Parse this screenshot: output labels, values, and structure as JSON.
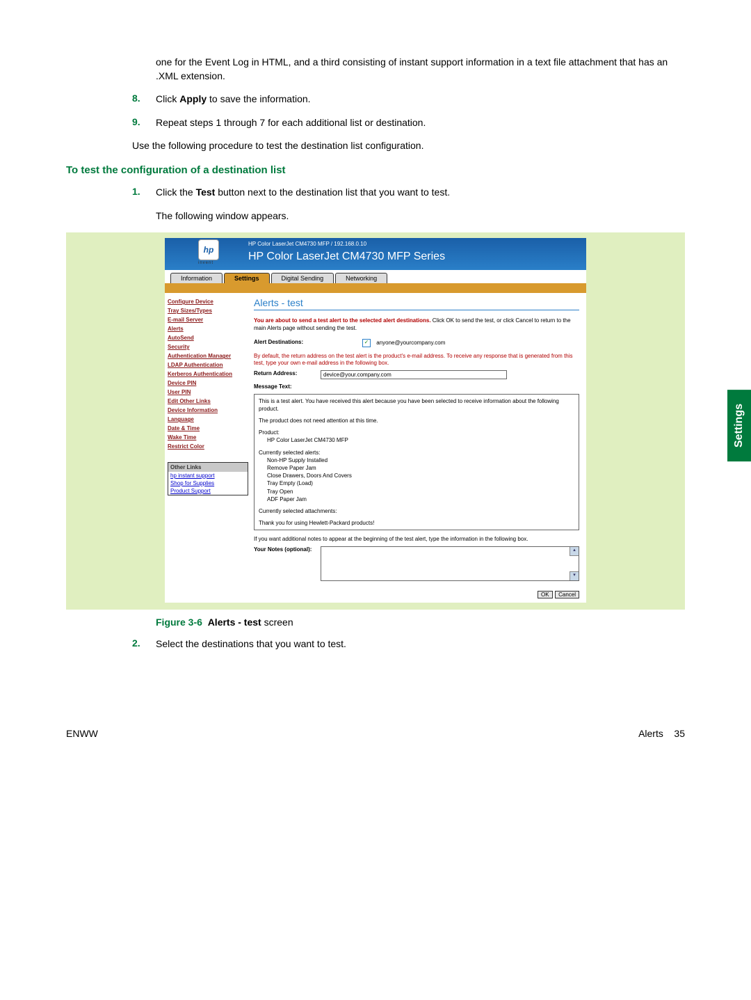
{
  "sideTab": "Settings",
  "introTrailing": "one for the Event Log in HTML, and a third consisting of instant support information in a text file attachment that has an .XML extension.",
  "steps_top": [
    {
      "num": "8.",
      "html": "Click <b>Apply</b> to save the information."
    },
    {
      "num": "9.",
      "html": "Repeat steps 1 through 7 for each additional list or destination."
    }
  ],
  "paraAfterTopSteps": "Use the following procedure to test the destination list configuration.",
  "heading": "To test the configuration of a destination list",
  "steps_mid": [
    {
      "num": "1.",
      "html": "Click the <b>Test</b> button next to the destination list that you want to test.",
      "sub": "The following window appears."
    }
  ],
  "figure": {
    "label": "Figure 3-6",
    "title_bold": "Alerts - test",
    "title_rest": " screen"
  },
  "steps_bottom": [
    {
      "num": "2.",
      "html": "Select the destinations that you want to test."
    }
  ],
  "footer": {
    "left": "ENWW",
    "right_label": "Alerts",
    "right_page": "35"
  },
  "screenshot": {
    "logo_text": "hp",
    "invent": "invent",
    "device_line": "HP Color LaserJet CM4730 MFP / 192.168.0.10",
    "device_title": "HP Color LaserJet CM4730 MFP Series",
    "tabs": [
      "Information",
      "Settings",
      "Digital Sending",
      "Networking"
    ],
    "active_tab": "Settings",
    "sidebar": [
      "Configure Device",
      "Tray Sizes/Types",
      "E-mail Server",
      "Alerts",
      "AutoSend",
      "Security",
      "Authentication Manager",
      "LDAP Authentication",
      "Kerberos Authentication",
      "Device PIN",
      "User PIN",
      "Edit Other Links",
      "Device Information",
      "Language",
      "Date & Time",
      "Wake Time",
      "Restrict Color"
    ],
    "other_links_title": "Other Links",
    "other_links": [
      "hp instant support",
      "Shop for Supplies",
      "Product Support"
    ],
    "panel_title": "Alerts - test",
    "warn_red": "You are about to send a test alert to the selected alert destinations.",
    "warn_rest": " Click OK to send the test, or click Cancel to return to the main Alerts page without sending the test.",
    "alert_dest_label": "Alert Destinations:",
    "alert_dest_value": "anyone@yourcompany.com",
    "return_note": "By default, the return address on the test alert is the product's e-mail address. To receive any response that is generated from this test, type your own e-mail address in the following box.",
    "return_label": "Return Address:",
    "return_value": "device@your.company.com",
    "msg_label": "Message Text:",
    "msg_intro": "This is a test alert. You have received this alert because you have been selected to receive information about the following product.",
    "msg_status": "The product does not need attention at this time.",
    "msg_product_label": "Product:",
    "msg_product_value": "HP Color LaserJet CM4730 MFP",
    "msg_alerts_label": "Currently selected alerts:",
    "msg_alerts": [
      "Non-HP Supply Installed",
      "Remove Paper Jam",
      "Close Drawers, Doors And Covers",
      "Tray Empty (Load)",
      "Tray Open",
      "ADF Paper Jam"
    ],
    "msg_attach_label": "Currently selected attachments:",
    "msg_thanks": "Thank you for using Hewlett-Packard products!",
    "notes_prompt": "If you want additional notes to appear at the beginning of the test alert, type the information in the following box.",
    "notes_label": "Your Notes (optional):",
    "btn_ok": "OK",
    "btn_cancel": "Cancel"
  }
}
